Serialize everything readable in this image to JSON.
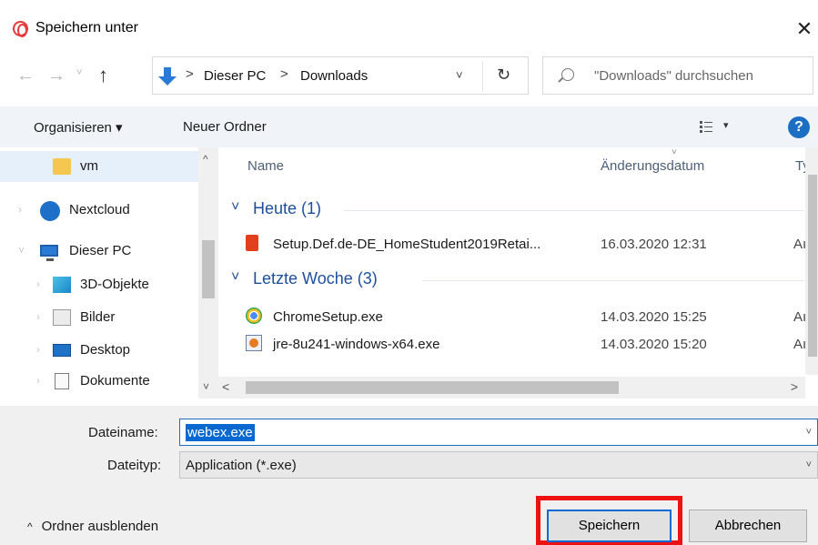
{
  "window": {
    "title": "Speichern unter",
    "close_glyph": "✕",
    "app_icon": "opera-icon"
  },
  "nav": {
    "back_glyph": "←",
    "forward_glyph": "→",
    "up_glyph": "↑",
    "history_glyph": "˅",
    "address": {
      "crumbs": [
        "Dieser PC",
        "Downloads"
      ],
      "separator": ">",
      "dropdown_glyph": "˅",
      "refresh_glyph": "↻"
    },
    "search": {
      "placeholder": "\"Downloads\" durchsuchen"
    }
  },
  "commandbar": {
    "organize_label": "Organisieren ▾",
    "newfolder_label": "Neuer Ordner",
    "view_dropdown_glyph": "▾",
    "help_glyph": "?"
  },
  "navpane": {
    "items": [
      {
        "label": "vm",
        "icon": "folder-icon",
        "selected": true
      },
      {
        "label": "Nextcloud",
        "icon": "nextcloud-icon"
      },
      {
        "label": "Dieser PC",
        "icon": "computer-icon"
      },
      {
        "label": "3D-Objekte",
        "icon": "3d-objects-icon"
      },
      {
        "label": "Bilder",
        "icon": "pictures-icon"
      },
      {
        "label": "Desktop",
        "icon": "desktop-icon"
      },
      {
        "label": "Dokumente",
        "icon": "documents-icon"
      }
    ],
    "scroll_up_glyph": "^",
    "scroll_down_glyph": "˅"
  },
  "filelist": {
    "columns": {
      "name": "Name",
      "date": "Änderungsdatum",
      "type": "Ty"
    },
    "sort_glyph": "˅",
    "groups": [
      {
        "title": "Heute (1)",
        "files": [
          {
            "name": "Setup.Def.de-DE_HomeStudent2019Retai...",
            "date": "16.03.2020 12:31",
            "type": "Aı",
            "icon": "office-icon"
          }
        ]
      },
      {
        "title": "Letzte Woche (3)",
        "files": [
          {
            "name": "ChromeSetup.exe",
            "date": "14.03.2020 15:25",
            "type": "Aı",
            "icon": "chrome-installer-icon"
          },
          {
            "name": "jre-8u241-windows-x64.exe",
            "date": "14.03.2020 15:20",
            "type": "Aı",
            "icon": "java-installer-icon"
          }
        ]
      }
    ],
    "group_chevron": "˅",
    "hscroll_left": "<",
    "hscroll_right": ">"
  },
  "form": {
    "filename_label": "Dateiname:",
    "filename_value": "webex.exe",
    "filetype_label": "Dateityp:",
    "filetype_value": "Application (*.exe)",
    "dropdown_glyph": "˅",
    "hide_folders_label": "Ordner ausblenden",
    "hide_folders_caret": "^",
    "save_label": "Speichern",
    "cancel_label": "Abbrechen",
    "highlight_color": "#ee1111"
  }
}
